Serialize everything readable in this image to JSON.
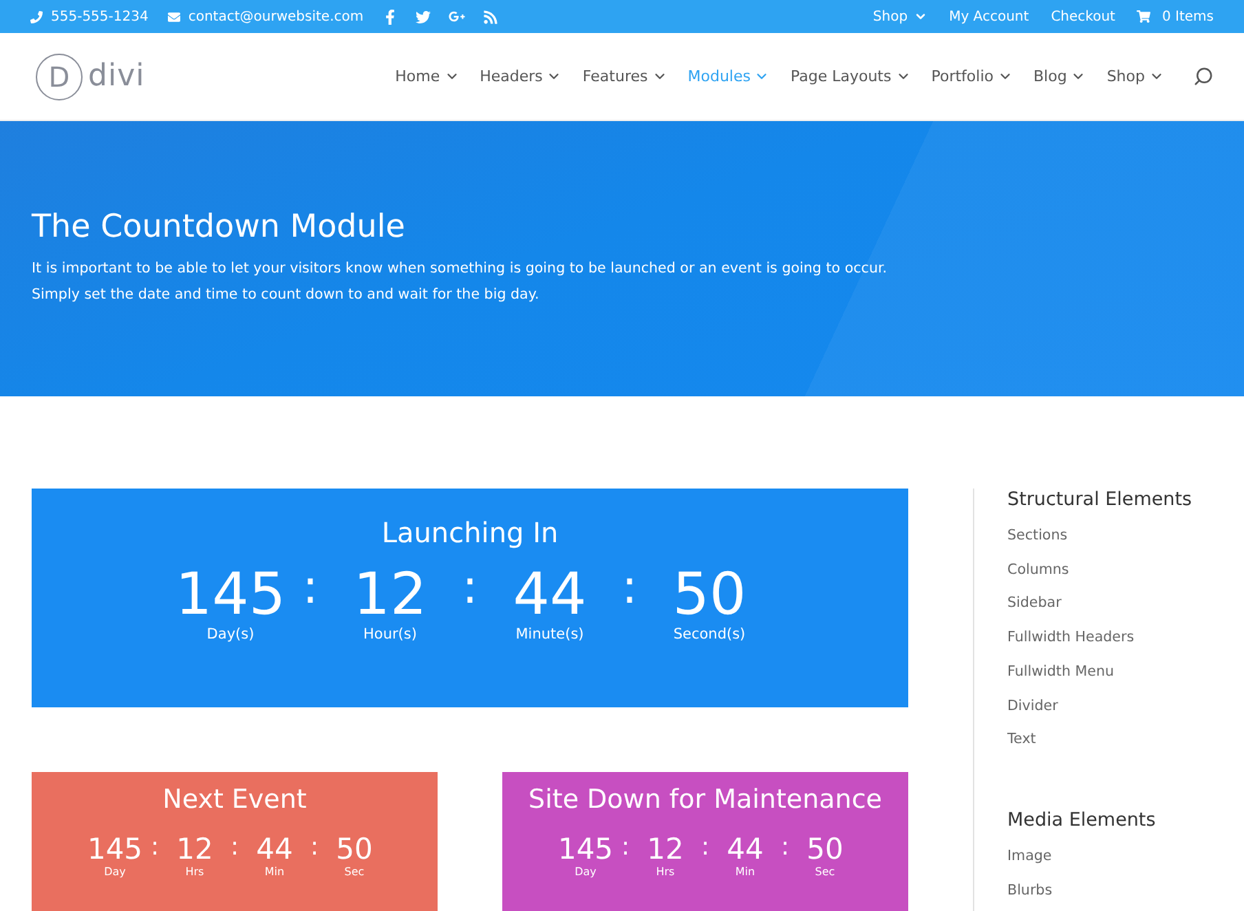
{
  "top_bar": {
    "phone": "555-555-1234",
    "email": "contact@ourwebsite.com",
    "links": [
      {
        "label": "Shop",
        "dropdown": true
      },
      {
        "label": "My Account",
        "dropdown": false
      },
      {
        "label": "Checkout",
        "dropdown": false
      }
    ],
    "cart": "0 Items"
  },
  "logo": {
    "letter": "D",
    "text": "divi"
  },
  "nav": [
    {
      "label": "Home",
      "selected": false
    },
    {
      "label": "Headers",
      "selected": false
    },
    {
      "label": "Features",
      "selected": false
    },
    {
      "label": "Modules",
      "selected": true
    },
    {
      "label": "Page Layouts",
      "selected": false
    },
    {
      "label": "Portfolio",
      "selected": false
    },
    {
      "label": "Blog",
      "selected": false
    },
    {
      "label": "Shop",
      "selected": false
    }
  ],
  "hero": {
    "title": "The Countdown Module",
    "text": "It is important to be able to let your visitors know when something is going to be launched or an event is going to occur. Simply set the date and time to count down to and wait for the big day."
  },
  "countdowns": [
    {
      "title": "Launching In",
      "kind": "large",
      "color": "#1a8cf2",
      "separator": ":",
      "units": [
        {
          "value": "145",
          "label": "Day(s)"
        },
        {
          "value": "12",
          "label": "Hour(s)"
        },
        {
          "value": "44",
          "label": "Minute(s)"
        },
        {
          "value": "50",
          "label": "Second(s)"
        }
      ]
    },
    {
      "title": "Next Event",
      "kind": "small",
      "color": "#e96f5f",
      "separator": ":",
      "units": [
        {
          "value": "145",
          "label": "Day"
        },
        {
          "value": "12",
          "label": "Hrs"
        },
        {
          "value": "44",
          "label": "Min"
        },
        {
          "value": "50",
          "label": "Sec"
        }
      ]
    },
    {
      "title": "Site Down for Maintenance",
      "kind": "small",
      "color": "#c74fc1",
      "separator": ":",
      "units": [
        {
          "value": "145",
          "label": "Day"
        },
        {
          "value": "12",
          "label": "Hrs"
        },
        {
          "value": "44",
          "label": "Min"
        },
        {
          "value": "50",
          "label": "Sec"
        }
      ]
    }
  ],
  "sidebar": [
    {
      "title": "Structural Elements",
      "links": [
        "Sections",
        "Columns",
        "Sidebar",
        "Fullwidth Headers",
        "Fullwidth Menu",
        "Divider",
        "Text"
      ]
    },
    {
      "title": "Media Elements",
      "links": [
        "Image",
        "Blurbs"
      ]
    }
  ]
}
